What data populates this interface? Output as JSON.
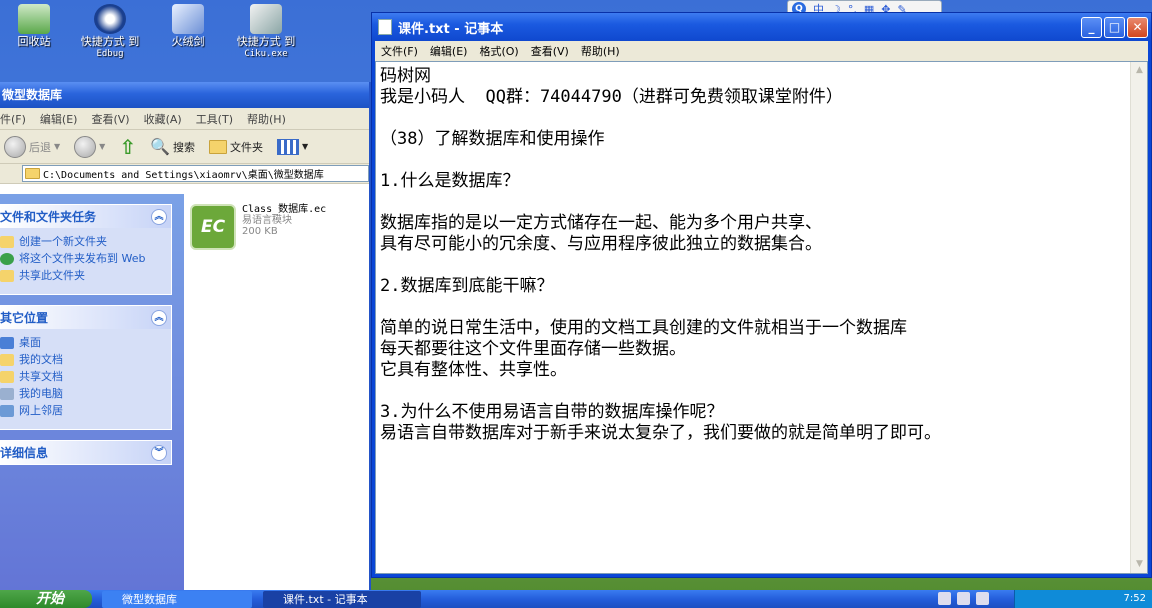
{
  "desktop": {
    "icons": [
      {
        "label": "回收站",
        "sub": ""
      },
      {
        "label": "快捷方式 到",
        "sub": "Edbug"
      },
      {
        "label": "火绒剑",
        "sub": ""
      },
      {
        "label": "快捷方式 到",
        "sub": "Ciku.exe"
      }
    ]
  },
  "explorer": {
    "title": "微型数据库",
    "menu": [
      "件(F)",
      "编辑(E)",
      "查看(V)",
      "收藏(A)",
      "工具(T)",
      "帮助(H)"
    ],
    "toolbar": {
      "back": "后退",
      "search": "搜索",
      "folders": "文件夹"
    },
    "address": "C:\\Documents and Settings\\xiaomrv\\桌面\\微型数据库",
    "tasks_panel": {
      "title": "文件和文件夹任务",
      "items": [
        "创建一个新文件夹",
        "将这个文件夹发布到 Web",
        "共享此文件夹"
      ]
    },
    "places_panel": {
      "title": "其它位置",
      "items": [
        "桌面",
        "我的文档",
        "共享文档",
        "我的电脑",
        "网上邻居"
      ]
    },
    "details_panel": {
      "title": "详细信息"
    },
    "file": {
      "name": "Class_数据库.ec",
      "type": "易语言模块",
      "size": "200 KB",
      "icon_text": "EC"
    }
  },
  "notepad": {
    "title": "课件.txt - 记事本",
    "menu": [
      "文件(F)",
      "编辑(E)",
      "格式(O)",
      "查看(V)",
      "帮助(H)"
    ],
    "content": "码树网\n我是小码人  QQ群：74044790（进群可免费领取课堂附件）\n\n（38）了解数据库和使用操作\n\n1.什么是数据库？\n\n数据库指的是以一定方式储存在一起、能为多个用户共享、\n具有尽可能小的冗余度、与应用程序彼此独立的数据集合。\n\n2.数据库到底能干嘛？\n\n简单的说日常生活中，使用的文档工具创建的文件就相当于一个数据库\n每天都要往这个文件里面存储一些数据。\n它具有整体性、共享性。\n\n3.为什么不使用易语言自带的数据库操作呢？\n易语言自带数据库对于新手来说太复杂了，我们要做的就是简单明了即可。"
  },
  "ime": {
    "mode": "中"
  },
  "taskbar": {
    "start": "开始",
    "tasks": [
      "微型数据库",
      "课件.txt - 记事本"
    ],
    "clock": "7:52"
  }
}
